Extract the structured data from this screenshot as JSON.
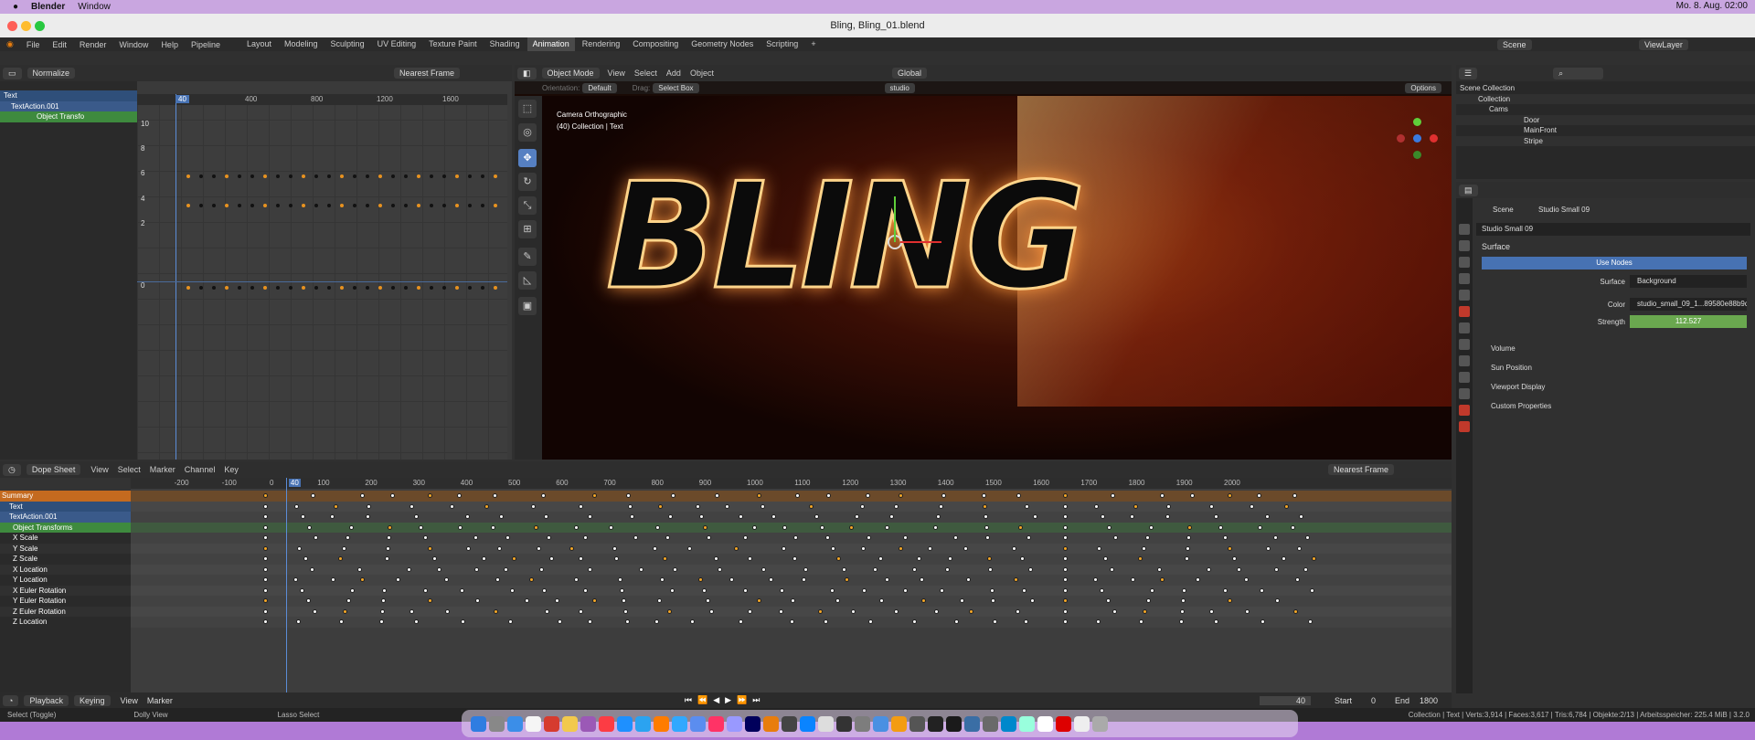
{
  "mac_menu": {
    "app": "Blender",
    "window": "Window",
    "datetime": "Mo. 8. Aug. 02:00"
  },
  "window_title": "Bling, Bling_01.blend",
  "topbar": {
    "menus": [
      "File",
      "Edit",
      "Render",
      "Window",
      "Help",
      "Pipeline"
    ],
    "workspaces": [
      "Layout",
      "Modeling",
      "Sculpting",
      "UV Editing",
      "Texture Paint",
      "Shading",
      "Animation",
      "Rendering",
      "Compositing",
      "Geometry Nodes",
      "Scripting"
    ],
    "active_workspace": "Animation",
    "scene": "Scene",
    "view_layer": "ViewLayer"
  },
  "graph_editor": {
    "normalize": "Normalize",
    "snap": "Nearest Frame",
    "channels": [
      "Text",
      "TextAction.001",
      "Object Transfo"
    ],
    "ruler": [
      "40",
      "400",
      "800",
      "1200",
      "1600"
    ],
    "yticks": [
      "10",
      "8",
      "6",
      "4",
      "2",
      "0"
    ]
  },
  "viewport": {
    "mode": "Object Mode",
    "menus": [
      "View",
      "Select",
      "Add",
      "Object"
    ],
    "orientation_label": "Orientation:",
    "orientation": "Default",
    "drag_label": "Drag:",
    "drag": "Select Box",
    "transform": "Global",
    "search": "studio",
    "options": "Options",
    "overlay_line1": "Camera Orthographic",
    "overlay_line2": "(40) Collection | Text",
    "scene_text": "BLING"
  },
  "outliner": {
    "items": [
      "Scene Collection",
      "Collection",
      "Cams",
      "Door",
      "MainFront",
      "Stripe"
    ]
  },
  "properties": {
    "breadcrumb_scene": "Scene",
    "breadcrumb_world": "Studio Small 09",
    "world_name": "Studio Small 09",
    "section_surface": "Surface",
    "use_nodes": "Use Nodes",
    "surface_label": "Surface",
    "surface_value": "Background",
    "color_label": "Color",
    "color_value": "studio_small_09_1...89580e88b9d9.exr",
    "strength_label": "Strength",
    "strength_value": "112.527",
    "sections": [
      "Volume",
      "Sun Position",
      "Viewport Display",
      "Custom Properties"
    ]
  },
  "dopesheet": {
    "mode": "Dope Sheet",
    "menus": [
      "View",
      "Select",
      "Marker",
      "Channel",
      "Key"
    ],
    "snap": "Nearest Frame",
    "ruler": [
      "-200",
      "-100",
      "0",
      "40",
      "100",
      "200",
      "300",
      "400",
      "500",
      "600",
      "700",
      "800",
      "900",
      "1000",
      "1100",
      "1200",
      "1300",
      "1400",
      "1500",
      "1600",
      "1700",
      "1800",
      "1900",
      "2000"
    ],
    "channels": [
      "Summary",
      "Text",
      "TextAction.001",
      "Object Transforms",
      "X Scale",
      "Y Scale",
      "Z Scale",
      "X Location",
      "Y Location",
      "X Euler Rotation",
      "Y Euler Rotation",
      "Z Euler Rotation",
      "Z Location"
    ]
  },
  "timeline": {
    "playback": "Playback",
    "keying": "Keying",
    "menus": [
      "View",
      "Marker"
    ],
    "current_frame": "40",
    "start_label": "Start",
    "start": "0",
    "end_label": "End",
    "end": "1800"
  },
  "statusbar": {
    "left1": "Select (Toggle)",
    "left2": "Dolly View",
    "left3": "Lasso Select",
    "right": "Collection | Text | Verts:3,914 | Faces:3,617 | Tris:6,784 | Objekte:2/13 | Arbeitsspeicher: 225.4 MiB | 3.2.0"
  }
}
